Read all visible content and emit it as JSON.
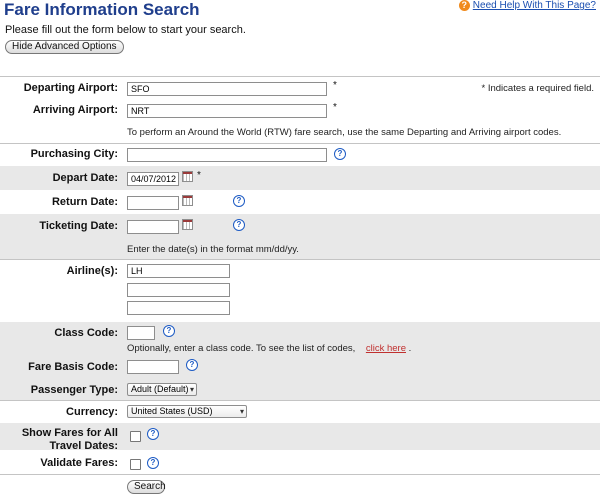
{
  "header": {
    "title": "Fare Information Search",
    "intro": "Please fill out the form below to start your search.",
    "advanced_button": "Hide Advanced Options",
    "help_link": "Need Help With This Page?"
  },
  "required_note": "Indicates a required field.",
  "required_mark": "*",
  "help_mark": "?",
  "form": {
    "departing": {
      "label": "Departing Airport:",
      "value": "SFO"
    },
    "arriving": {
      "label": "Arriving Airport:",
      "value": "NRT"
    },
    "rtw_note": "To perform an Around the World (RTW) fare search, use the same Departing and Arriving airport codes.",
    "purchasing_city": {
      "label": "Purchasing City:",
      "value": ""
    },
    "depart_date": {
      "label": "Depart Date:",
      "value": "04/07/2012"
    },
    "return_date": {
      "label": "Return Date:",
      "value": ""
    },
    "ticketing_date": {
      "label": "Ticketing Date:",
      "value": ""
    },
    "date_note": "Enter the date(s) in the format mm/dd/yy.",
    "airlines": {
      "label": "Airline(s):",
      "values": [
        "LH",
        "",
        ""
      ]
    },
    "class_code": {
      "label": "Class Code:",
      "value": ""
    },
    "class_note": "Optionally, enter a class code. To see the list of codes,",
    "class_link": "click here",
    "class_note_end": ".",
    "fare_basis": {
      "label": "Fare Basis Code:",
      "value": ""
    },
    "passenger_type": {
      "label": "Passenger Type:",
      "selected": "Adult (Default)"
    },
    "currency": {
      "label": "Currency:",
      "selected": "United States (USD)"
    },
    "show_fares": {
      "label_line1": "Show Fares for All",
      "label_line2": "Travel Dates:",
      "checked": false
    },
    "validate": {
      "label": "Validate Fares:",
      "checked": false
    },
    "search_button": "Search"
  },
  "colors": {
    "title": "#1f3e8c",
    "band": "#e8e8e8",
    "help_icon": "#f08a1c",
    "link": "#c0302f"
  }
}
